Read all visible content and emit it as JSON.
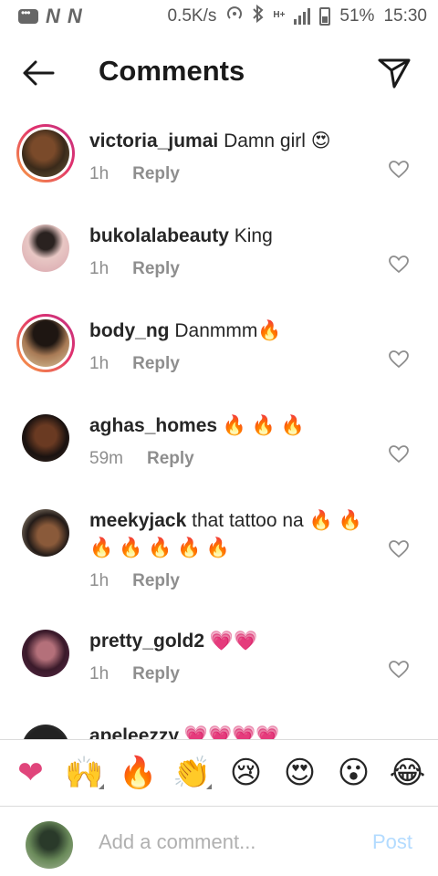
{
  "status_bar": {
    "net_speed": "0.5K/s",
    "network_type": "H+",
    "battery": "51%",
    "time": "15:30",
    "carrier_glyph": "N"
  },
  "header": {
    "title": "Comments",
    "back_icon": "arrow-left-icon",
    "send_icon": "paper-plane-icon"
  },
  "comments": [
    {
      "username": "victoria_jumai",
      "text": "Damn girl 😍",
      "time": "1h",
      "reply_label": "Reply",
      "story_ring": true
    },
    {
      "username": "bukolalabeauty",
      "text": "King",
      "time": "1h",
      "reply_label": "Reply",
      "story_ring": false
    },
    {
      "username": "body_ng",
      "text": "Danmmm🔥",
      "time": "1h",
      "reply_label": "Reply",
      "story_ring": true
    },
    {
      "username": "aghas_homes",
      "text": "🔥 🔥 🔥",
      "time": "59m",
      "reply_label": "Reply",
      "story_ring": false
    },
    {
      "username": "meekyjack",
      "text": "that tattoo na 🔥 🔥 🔥 🔥 🔥 🔥 🔥",
      "time": "1h",
      "reply_label": "Reply",
      "story_ring": false
    },
    {
      "username": "pretty_gold2",
      "text": "💗💗",
      "time": "1h",
      "reply_label": "Reply",
      "story_ring": false
    },
    {
      "username": "apeleezzy",
      "text": "💗💗💗💗",
      "time": "",
      "reply_label": "",
      "story_ring": false
    }
  ],
  "emoji_bar": [
    "❤",
    "🙌",
    "🔥",
    "👏",
    "😢",
    "😍",
    "😮",
    "😂"
  ],
  "compose": {
    "placeholder": "Add a comment...",
    "post_label": "Post"
  },
  "colors": {
    "accent_blue_disabled": "#b3dbff",
    "secondary_text": "#8e8e8e",
    "story_ring_start": "#f9a341",
    "story_ring_end": "#c13584"
  }
}
